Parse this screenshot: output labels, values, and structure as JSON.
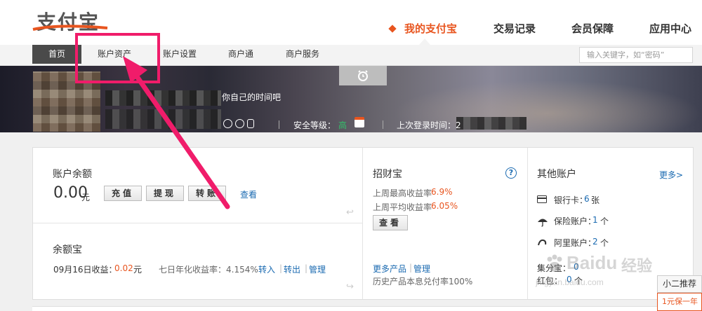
{
  "header": {
    "logo_text": "支付宝",
    "nav": [
      {
        "label": "我的支付宝",
        "active": true
      },
      {
        "label": "交易记录",
        "active": false
      },
      {
        "label": "会员保障",
        "active": false
      },
      {
        "label": "应用中心",
        "active": false
      }
    ]
  },
  "subnav": {
    "items": [
      "首页",
      "账户资产",
      "账户设置",
      "商户通",
      "商户服务"
    ],
    "search_placeholder": "输入关键字，如“密码”"
  },
  "banner": {
    "tagline": "你自己的时间吧",
    "security_label": "安全等级：",
    "security_value": "高",
    "last_login_label": "上次登录时间：2"
  },
  "balance": {
    "title": "账户余额",
    "amount": "0.00",
    "unit": "元",
    "recharge": "充值",
    "withdraw": "提现",
    "transfer": "转账",
    "view": "查看"
  },
  "yuebao": {
    "title": "余额宝",
    "date_income_label": "09月16日收益：",
    "income_value": "0.02",
    "income_unit": "元",
    "annual_label": "七日年化收益率：4.154%",
    "transfer_in": "转入",
    "transfer_out": "转出",
    "manage": "管理"
  },
  "zhaocaibao": {
    "title": "招财宝",
    "week_high_label": "上周最高收益率",
    "week_high_value": "6.9%",
    "week_avg_label": "上周平均收益率",
    "week_avg_value": "6.05%",
    "view": "查看",
    "more_products": "更多产品",
    "manage": "管理",
    "history": "历史产品本息兑付率100%"
  },
  "other_accounts": {
    "title": "其他账户",
    "more": "更多>",
    "bank_label": "银行卡：",
    "bank_count": "6",
    "bank_unit": "张",
    "insurance_label": "保险账户：",
    "insurance_count": "1",
    "insurance_unit": "个",
    "alimama_label": "阿里账户：",
    "alimama_count": "2",
    "alimama_unit": "个",
    "jifen_label": "集分宝：",
    "jifen_count": "0",
    "hongbao_label": "红包：",
    "hongbao_count": "0",
    "hongbao_unit": "个"
  },
  "floating": {
    "xiaoer": "小二推荐",
    "promo": "1元保一年"
  },
  "watermark": {
    "brand": "Baidu",
    "brand_cn": "经验",
    "url": "jingyan.baidu.com"
  },
  "colors": {
    "accent": "#e8551f",
    "link": "#1a6ab1",
    "highlight": "#f01c6a",
    "safe_green": "#34c06b"
  }
}
